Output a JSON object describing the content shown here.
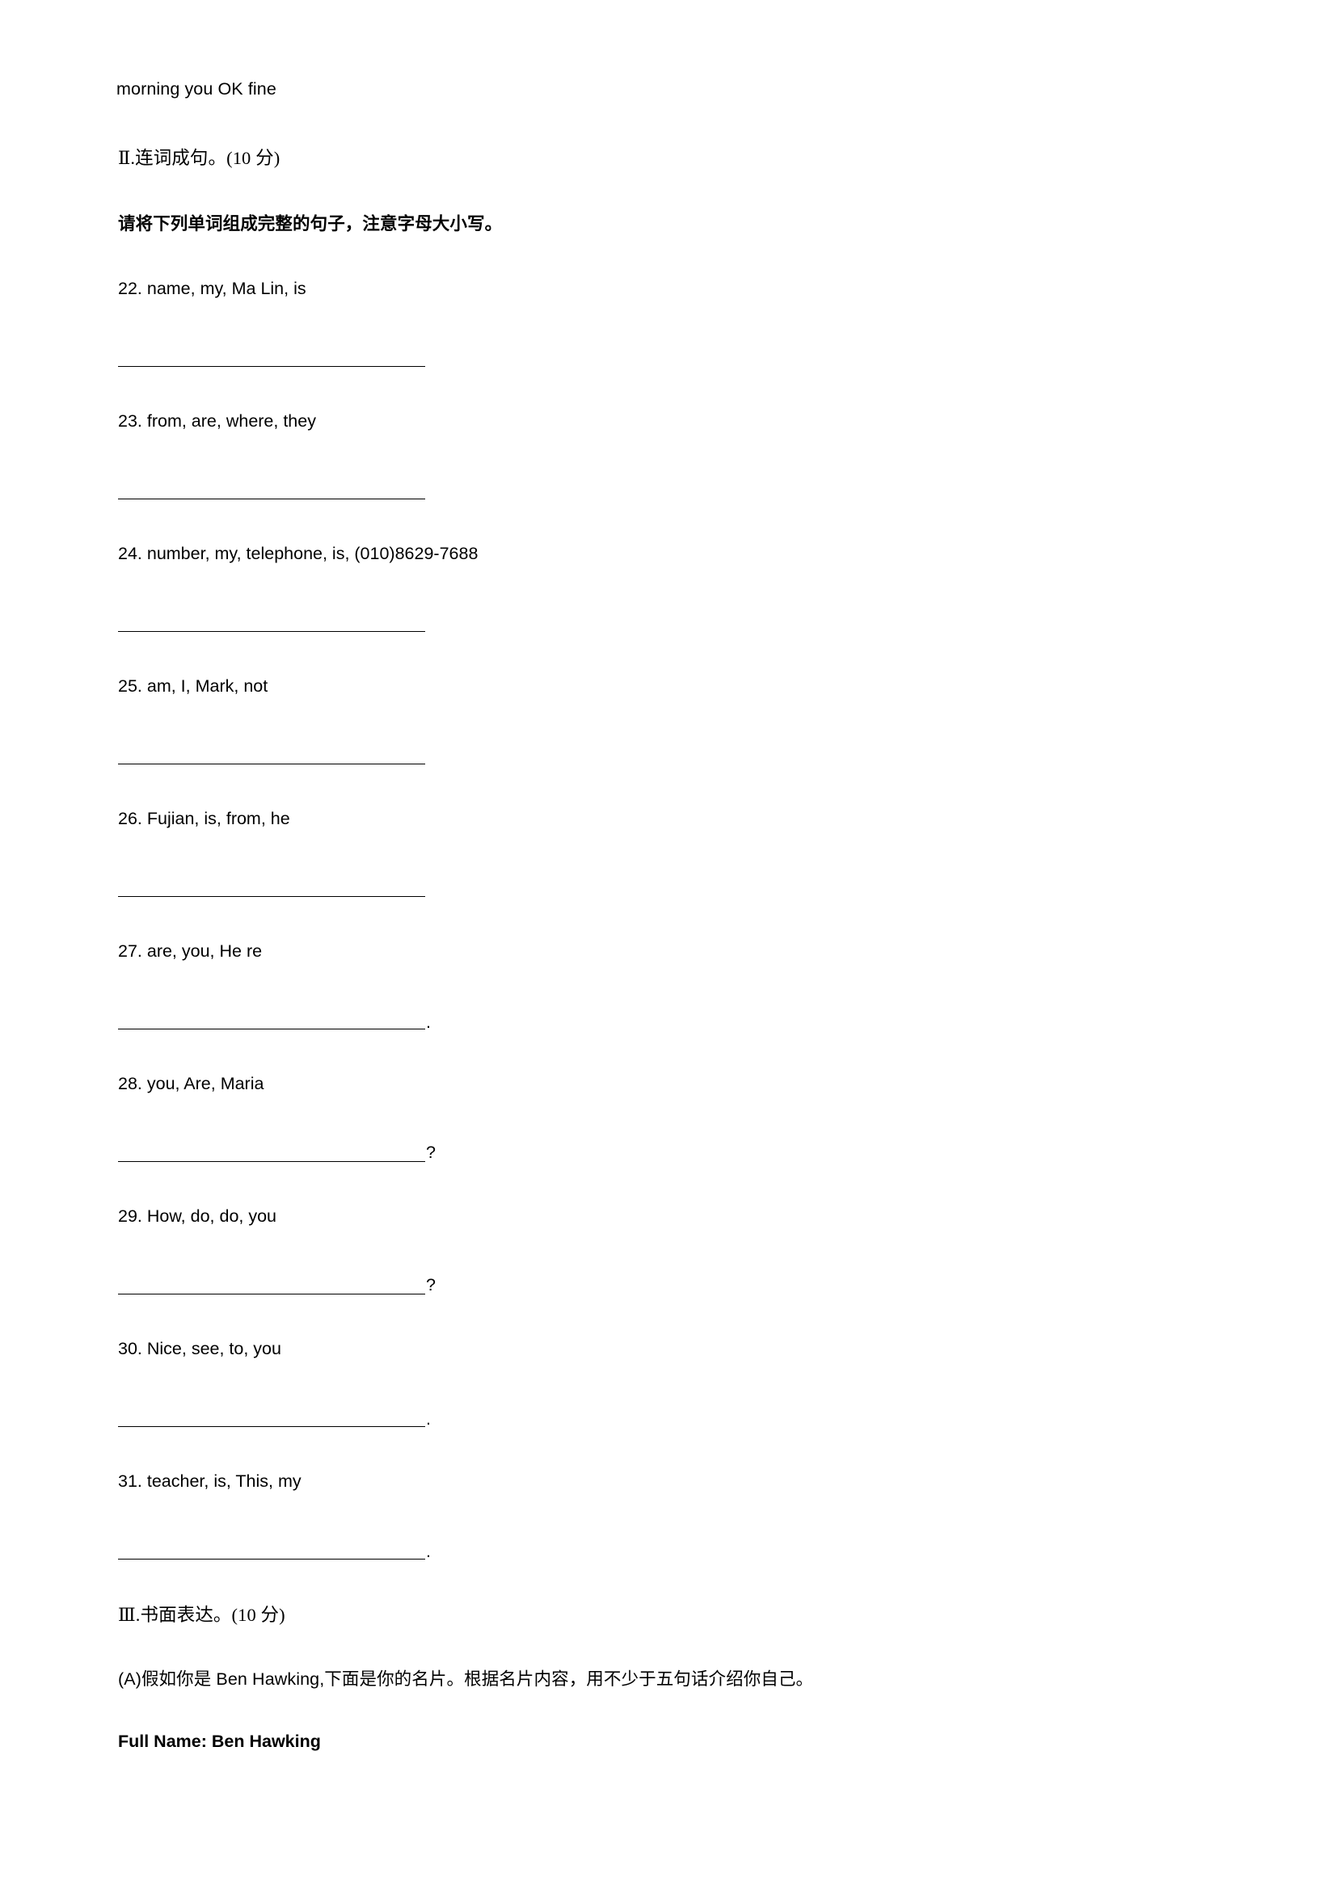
{
  "document": {
    "word_bank_line": "morning you OK fine",
    "section2": {
      "heading": "Ⅱ.连词成句。(10 分)",
      "instruction": "请将下列单词组成完整的句子，注意字母大小写。",
      "items": [
        {
          "number": "22.",
          "text": "22. name, my, Ma Lin, is",
          "blank_punct": ""
        },
        {
          "number": "23.",
          "text": "23. from, are, where, they",
          "blank_punct": ""
        },
        {
          "number": "24.",
          "text": "24. number, my, telephone, is, (010)8629-7688",
          "blank_punct": ""
        },
        {
          "number": "25.",
          "text": "25. am, I, Mark, not",
          "blank_punct": ""
        },
        {
          "number": "26.",
          "text": "26. Fujian, is, from, he",
          "blank_punct": ""
        },
        {
          "number": "27.",
          "text": "27. are, you, He re",
          "blank_punct": "."
        },
        {
          "number": "28.",
          "text": "28. you, Are, Maria",
          "blank_punct": "?"
        },
        {
          "number": "29.",
          "text": "29. How, do, do, you",
          "blank_punct": "?"
        },
        {
          "number": "30.",
          "text": "30. Nice, see, to, you",
          "blank_punct": "."
        },
        {
          "number": "31.",
          "text": "31. teacher, is, This, my",
          "blank_punct": "."
        }
      ]
    },
    "section3": {
      "heading": "Ⅲ.书面表达。(10 分)",
      "prompt": "(A)假如你是 Ben Hawking,下面是你的名片。根据名片内容，用不少于五句话介绍你自己。",
      "card": {
        "full_name_line": "Full Name: Ben Hawking"
      }
    }
  }
}
